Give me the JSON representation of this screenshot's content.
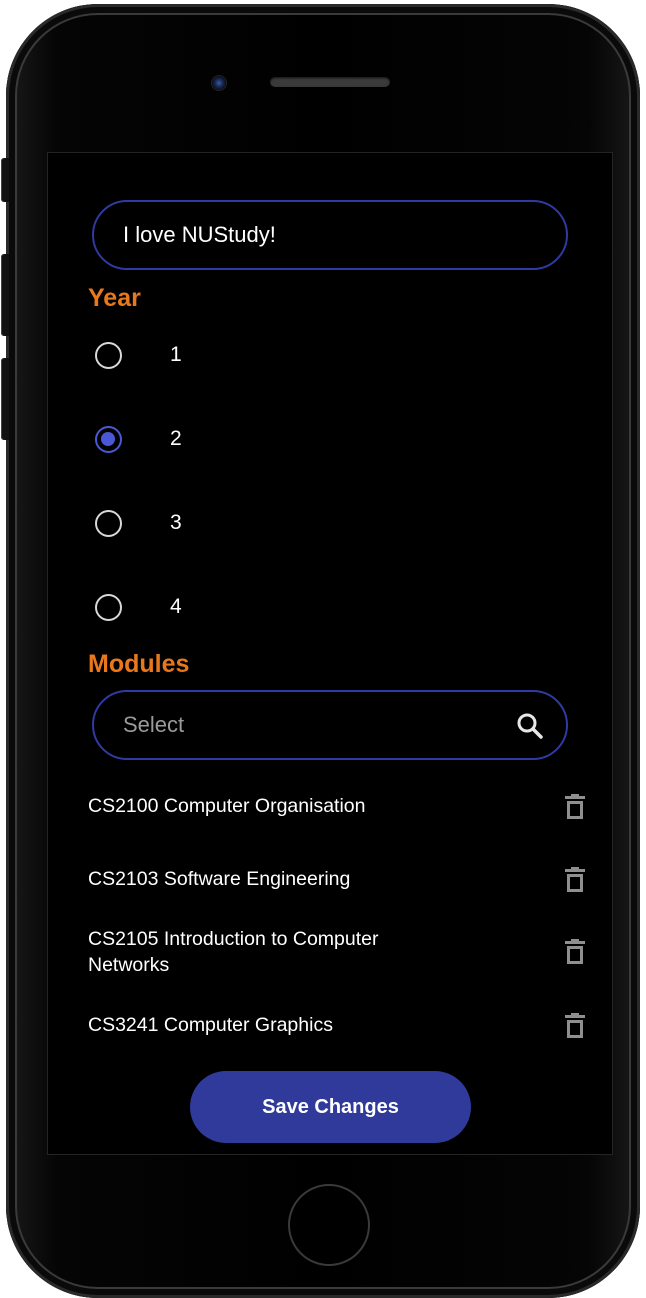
{
  "profile": {
    "bio_value": "I love NUStudy!"
  },
  "year": {
    "title": "Year",
    "options": [
      {
        "label": "1",
        "checked": false
      },
      {
        "label": "2",
        "checked": true
      },
      {
        "label": "3",
        "checked": false
      },
      {
        "label": "4",
        "checked": false
      }
    ]
  },
  "modules": {
    "title": "Modules",
    "search_placeholder": "Select",
    "items": [
      {
        "name": "CS2100 Computer Organisation"
      },
      {
        "name": "CS2103 Software Engineering"
      },
      {
        "name": "CS2105 Introduction to Computer Networks"
      },
      {
        "name": "CS3241 Computer Graphics"
      }
    ]
  },
  "actions": {
    "save_label": "Save Changes"
  },
  "colors": {
    "accent_orange": "#e8781c",
    "primary_blue": "#303a9a",
    "radio_selected": "#4a58d6",
    "field_border": "#2f3aa3"
  },
  "icons": {
    "search": "search-icon",
    "delete": "trash-icon"
  }
}
